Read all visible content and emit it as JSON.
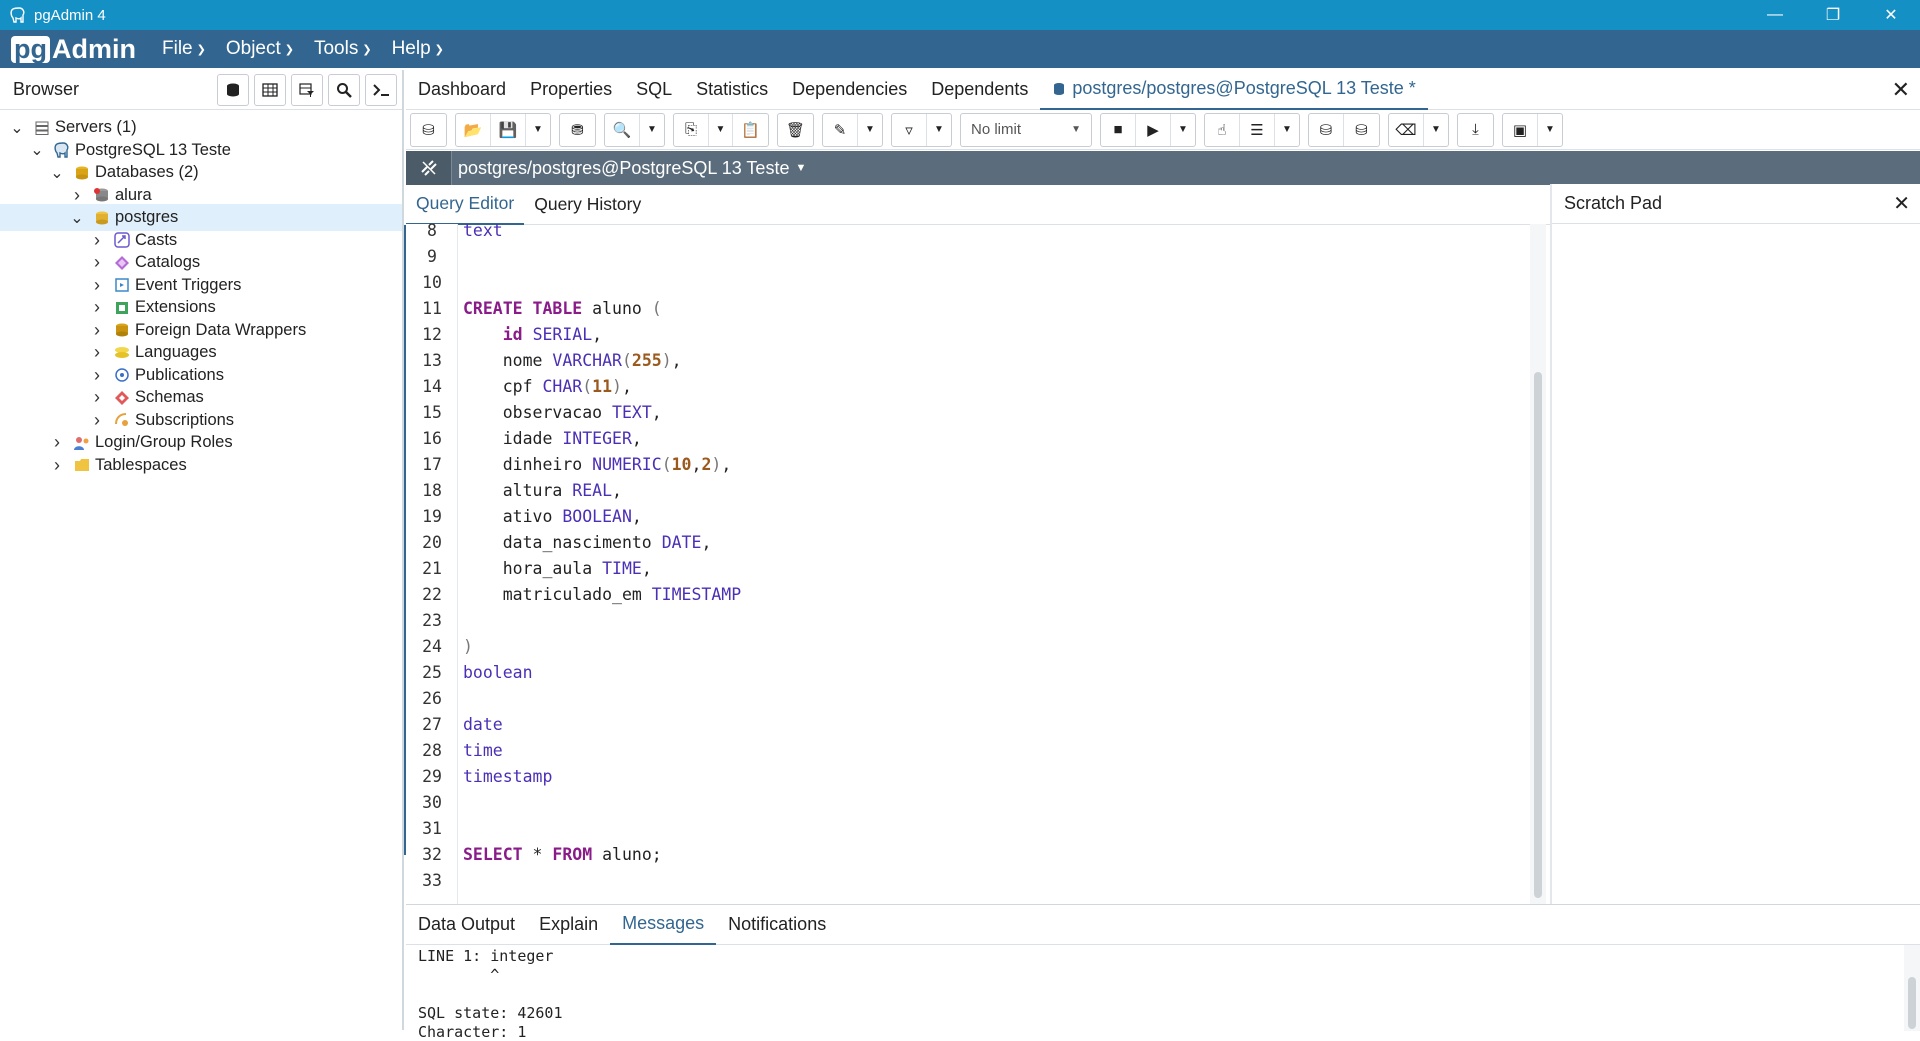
{
  "window": {
    "title": "pgAdmin 4",
    "controls": [
      "—",
      "❐",
      "✕"
    ]
  },
  "menubar": {
    "logo_pg": "pg",
    "logo_rest": "Admin",
    "menus": [
      "File",
      "Object",
      "Tools",
      "Help"
    ]
  },
  "browser": {
    "label": "Browser",
    "tree": [
      {
        "label": "Servers (1)",
        "icon": "servers-icon",
        "expanded": true
      },
      {
        "label": "PostgreSQL 13 Teste",
        "icon": "elephant-icon",
        "expanded": true
      },
      {
        "label": "Databases (2)",
        "icon": "databases-icon",
        "expanded": true
      },
      {
        "label": "alura",
        "icon": "database-disconnected-icon",
        "expanded": false
      },
      {
        "label": "postgres",
        "icon": "database-icon",
        "expanded": true,
        "selected": true
      },
      {
        "label": "Casts",
        "icon": "casts-icon",
        "expanded": false
      },
      {
        "label": "Catalogs",
        "icon": "catalogs-icon",
        "expanded": false
      },
      {
        "label": "Event Triggers",
        "icon": "event-triggers-icon",
        "expanded": false
      },
      {
        "label": "Extensions",
        "icon": "extensions-icon",
        "expanded": false
      },
      {
        "label": "Foreign Data Wrappers",
        "icon": "fdw-icon",
        "expanded": false
      },
      {
        "label": "Languages",
        "icon": "languages-icon",
        "expanded": false
      },
      {
        "label": "Publications",
        "icon": "publications-icon",
        "expanded": false
      },
      {
        "label": "Schemas",
        "icon": "schemas-icon",
        "expanded": false
      },
      {
        "label": "Subscriptions",
        "icon": "subscriptions-icon",
        "expanded": false
      },
      {
        "label": "Login/Group Roles",
        "icon": "roles-icon",
        "expanded": false
      },
      {
        "label": "Tablespaces",
        "icon": "tablespaces-icon",
        "expanded": false
      }
    ]
  },
  "main_tabs": [
    "Dashboard",
    "Properties",
    "SQL",
    "Statistics",
    "Dependencies",
    "Dependents"
  ],
  "active_tab": "postgres/postgres@PostgreSQL 13 Teste *",
  "toolbar": {
    "limit": "No limit"
  },
  "connection": "postgres/postgres@PostgreSQL 13 Teste",
  "editor_tabs": [
    "Query Editor",
    "Query History"
  ],
  "scratch_pad": "Scratch Pad",
  "editor_lines": [
    {
      "n": "8",
      "tokens": [
        [
          "ty",
          "text"
        ]
      ]
    },
    {
      "n": "9",
      "tokens": []
    },
    {
      "n": "10",
      "tokens": []
    },
    {
      "n": "11",
      "tokens": [
        [
          "kw",
          "CREATE"
        ],
        [
          "",
          " "
        ],
        [
          "kw",
          "TABLE"
        ],
        [
          "",
          " aluno "
        ],
        [
          "pu",
          "("
        ]
      ]
    },
    {
      "n": "12",
      "tokens": [
        [
          "",
          "    "
        ],
        [
          "kw",
          "id"
        ],
        [
          "",
          " "
        ],
        [
          "ty",
          "SERIAL"
        ],
        [
          "",
          ","
        ]
      ]
    },
    {
      "n": "13",
      "tokens": [
        [
          "",
          "    nome "
        ],
        [
          "ty",
          "VARCHAR"
        ],
        [
          "pu",
          "("
        ],
        [
          "nm",
          "255"
        ],
        [
          "pu",
          ")"
        ],
        [
          "",
          ","
        ]
      ]
    },
    {
      "n": "14",
      "tokens": [
        [
          "",
          "    cpf "
        ],
        [
          "ty",
          "CHAR"
        ],
        [
          "pu",
          "("
        ],
        [
          "nm",
          "11"
        ],
        [
          "pu",
          ")"
        ],
        [
          "",
          ","
        ]
      ]
    },
    {
      "n": "15",
      "tokens": [
        [
          "",
          "    observacao "
        ],
        [
          "ty",
          "TEXT"
        ],
        [
          "",
          ","
        ]
      ]
    },
    {
      "n": "16",
      "tokens": [
        [
          "",
          "    idade "
        ],
        [
          "ty",
          "INTEGER"
        ],
        [
          "",
          ","
        ]
      ]
    },
    {
      "n": "17",
      "tokens": [
        [
          "",
          "    dinheiro "
        ],
        [
          "ty",
          "NUMERIC"
        ],
        [
          "pu",
          "("
        ],
        [
          "nm",
          "10"
        ],
        [
          "",
          ","
        ],
        [
          "nm",
          "2"
        ],
        [
          "pu",
          ")"
        ],
        [
          "",
          ","
        ]
      ]
    },
    {
      "n": "18",
      "tokens": [
        [
          "",
          "    altura "
        ],
        [
          "ty",
          "REAL"
        ],
        [
          "",
          ","
        ]
      ]
    },
    {
      "n": "19",
      "tokens": [
        [
          "",
          "    ativo "
        ],
        [
          "ty",
          "BOOLEAN"
        ],
        [
          "",
          ","
        ]
      ]
    },
    {
      "n": "20",
      "tokens": [
        [
          "",
          "    data_nascimento "
        ],
        [
          "ty",
          "DATE"
        ],
        [
          "",
          ","
        ]
      ]
    },
    {
      "n": "21",
      "tokens": [
        [
          "",
          "    hora_aula "
        ],
        [
          "ty",
          "TIME"
        ],
        [
          "",
          ","
        ]
      ]
    },
    {
      "n": "22",
      "tokens": [
        [
          "",
          "    matriculado_em "
        ],
        [
          "ty",
          "TIMESTAMP"
        ]
      ]
    },
    {
      "n": "23",
      "tokens": []
    },
    {
      "n": "24",
      "tokens": [
        [
          "pu",
          ")"
        ]
      ]
    },
    {
      "n": "25",
      "tokens": [
        [
          "ty",
          "boolean"
        ]
      ]
    },
    {
      "n": "26",
      "tokens": []
    },
    {
      "n": "27",
      "tokens": [
        [
          "ty",
          "date"
        ]
      ]
    },
    {
      "n": "28",
      "tokens": [
        [
          "ty",
          "time"
        ]
      ]
    },
    {
      "n": "29",
      "tokens": [
        [
          "ty",
          "timestamp"
        ]
      ]
    },
    {
      "n": "30",
      "tokens": []
    },
    {
      "n": "31",
      "tokens": []
    },
    {
      "n": "32",
      "tokens": [
        [
          "kw",
          "SELECT"
        ],
        [
          "",
          " * "
        ],
        [
          "kw",
          "FROM"
        ],
        [
          "",
          " aluno;"
        ]
      ]
    },
    {
      "n": "33",
      "tokens": []
    }
  ],
  "output_tabs": [
    "Data Output",
    "Explain",
    "Messages",
    "Notifications"
  ],
  "active_output_tab": "Messages",
  "messages": [
    "LINE 1: integer",
    "        ^",
    "",
    "SQL state: 42601",
    "Character: 1"
  ],
  "colors": {
    "titlebar": "#1590c5",
    "menubar": "#326690",
    "accent": "#326690",
    "connbar": "#5b6d7c"
  }
}
